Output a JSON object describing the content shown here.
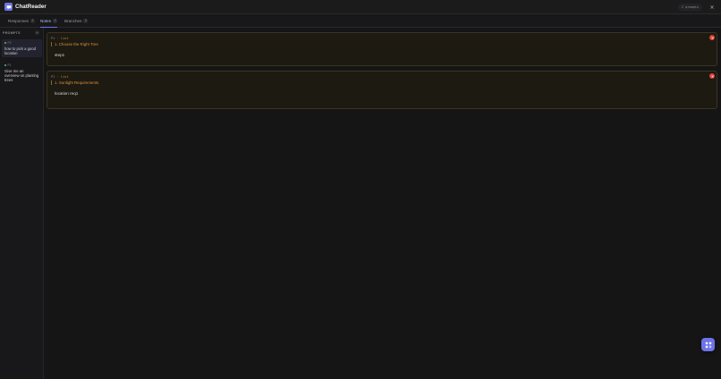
{
  "app": {
    "title": "ChatReader",
    "prompt_count": "2 prompts"
  },
  "tabs": [
    {
      "label": "Responses",
      "count": "2"
    },
    {
      "label": "Notes",
      "count": "2"
    },
    {
      "label": "Branches",
      "count": "0"
    }
  ],
  "sidebar": {
    "heading": "PROMPTS",
    "add_label": "+",
    "items": [
      {
        "number": "P2",
        "text": "how to pick a good location"
      },
      {
        "number": "P1",
        "text": "Give me an overview on planting trees"
      }
    ]
  },
  "notes": [
    {
      "prompt": "P1",
      "type": "list",
      "quote": "1. Choose the Right Tree",
      "note": "step1"
    },
    {
      "prompt": "P1",
      "type": "list",
      "quote": "1. Sunlight Requirements",
      "note": "location req1"
    }
  ],
  "icons": {
    "logo": "chat-bubble-icon",
    "close": "close-icon",
    "delete": "delete-icon",
    "fab": "grid-icon"
  },
  "colors": {
    "accent": "#6d73e6",
    "note_border": "#3a3420",
    "quote": "#d9923c",
    "delete": "#e0423a",
    "status_dot": "#4fc27a"
  }
}
